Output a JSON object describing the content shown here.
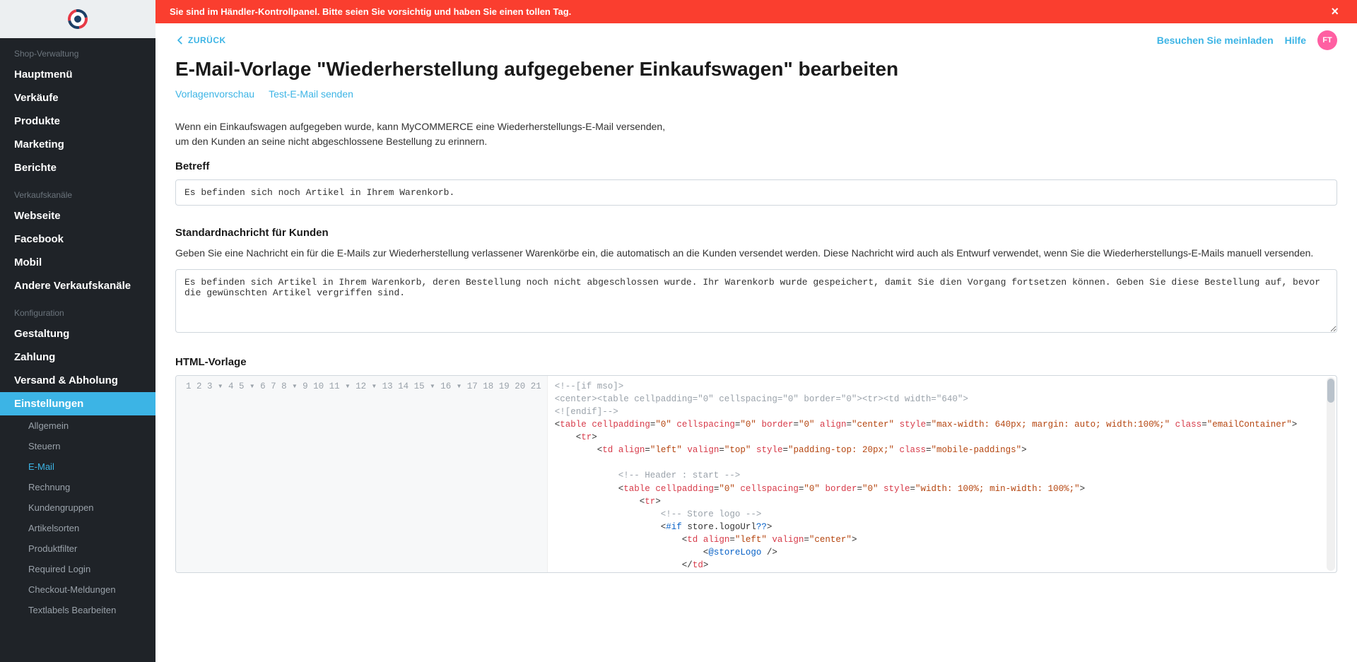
{
  "banner": {
    "text": "Sie sind im Händler-Kontrollpanel. Bitte seien Sie vorsichtig und haben Sie einen tollen Tag."
  },
  "sidebar": {
    "section1_label": "Shop-Verwaltung",
    "section1_items": [
      "Hauptmenü",
      "Verkäufe",
      "Produkte",
      "Marketing",
      "Berichte"
    ],
    "section2_label": "Verkaufskanäle",
    "section2_items": [
      "Webseite",
      "Facebook",
      "Mobil",
      "Andere Verkaufskanäle"
    ],
    "section3_label": "Konfiguration",
    "section3_items": [
      "Gestaltung",
      "Zahlung",
      "Versand & Abholung",
      "Einstellungen"
    ],
    "sub_items": [
      "Allgemein",
      "Steuern",
      "E-Mail",
      "Rechnung",
      "Kundengruppen",
      "Artikelsorten",
      "Produktfilter",
      "Required Login",
      "Checkout-Meldungen",
      "Textlabels Bearbeiten"
    ]
  },
  "topbar": {
    "back": "ZURÜCK",
    "visit": "Besuchen Sie meinladen",
    "help": "Hilfe",
    "avatar": "FT"
  },
  "page": {
    "title": "E-Mail-Vorlage \"Wiederherstellung aufgegebener Einkaufswagen\" bearbeiten",
    "action_preview": "Vorlagenvorschau",
    "action_test": "Test-E-Mail senden",
    "intro_line1": "Wenn ein Einkaufswagen aufgegeben wurde, kann MyCOMMERCE eine Wiederherstellungs-E-Mail versenden,",
    "intro_line2": "um den Kunden an seine nicht abgeschlossene Bestellung zu erinnern.",
    "subject_label": "Betreff",
    "subject_value": "Es befinden sich noch Artikel in Ihrem Warenkorb.",
    "default_msg_label": "Standardnachricht für Kunden",
    "default_msg_help": "Geben Sie eine Nachricht ein für die E-Mails zur Wiederherstellung verlassener Warenkörbe ein, die automatisch an die Kunden versendet werden. Diese Nachricht wird auch als Entwurf verwendet, wenn Sie die Wiederherstellungs-E-Mails manuell versenden.",
    "default_msg_value": "Es befinden sich Artikel in Ihrem Warenkorb, deren Bestellung noch nicht abgeschlossen wurde. Ihr Warenkorb wurde gespeichert, damit Sie dien Vorgang fortsetzen können. Geben Sie diese Bestellung auf, bevor die gewünschten Artikel vergriffen sind.",
    "html_label": "HTML-Vorlage"
  },
  "code": {
    "line_count": 21,
    "arrow_lines": [
      4,
      6,
      9,
      12,
      13,
      16,
      17
    ]
  }
}
